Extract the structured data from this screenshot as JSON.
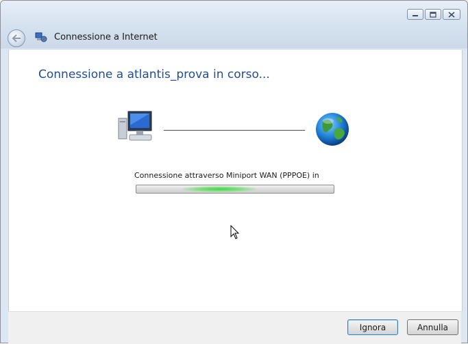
{
  "window": {
    "title": "Connessione a Internet",
    "caption_buttons": {
      "minimize": "minimize-icon",
      "maximize": "maximize-icon",
      "close": "close-icon"
    }
  },
  "main": {
    "heading": "Connessione a atlantis_prova in corso...",
    "status": "Connessione attraverso Miniport WAN (PPPOE) in",
    "progress_state": "indeterminate",
    "icons": {
      "computer": "computer-icon",
      "network": "globe-icon"
    }
  },
  "footer": {
    "ignore_label": "Ignora",
    "cancel_label": "Annulla"
  },
  "colors": {
    "heading": "#1f4e93",
    "progress_glow": "#3fd44a"
  }
}
